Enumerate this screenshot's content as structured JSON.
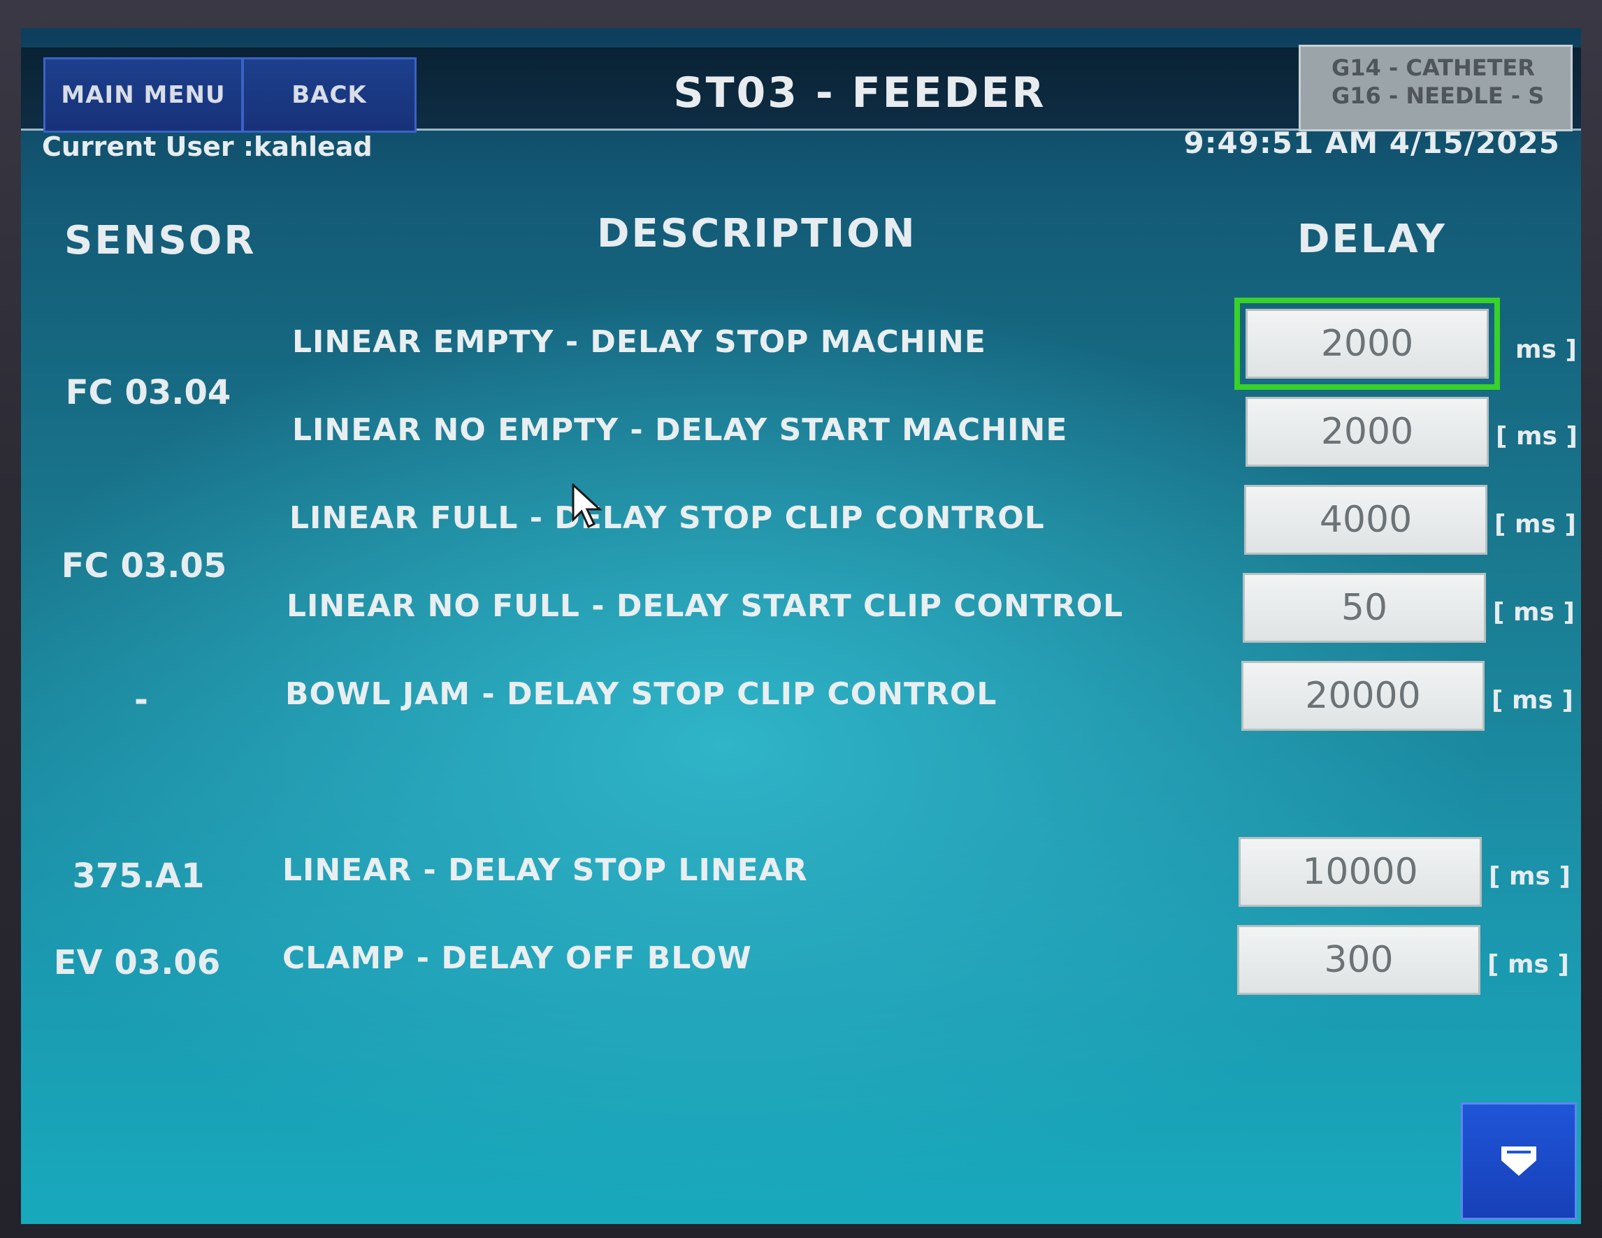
{
  "header": {
    "main_menu_label": "MAIN MENU",
    "back_label": "BACK",
    "title": "ST03 - FEEDER",
    "recipe_line1": "G14 - CATHETER",
    "recipe_line2": "G16 - NEEDLE - S"
  },
  "status": {
    "current_user": "Current User :kahlead",
    "datetime": "9:49:51 AM 4/15/2025"
  },
  "columns": {
    "sensor": "SENSOR",
    "description": "DESCRIPTION",
    "delay": "DELAY"
  },
  "sensors": [
    "FC 03.04",
    "FC 03.05",
    "-",
    "375.A1",
    "EV 03.06"
  ],
  "rows": [
    {
      "description": "LINEAR EMPTY - DELAY STOP MACHINE",
      "value": "2000",
      "unit": "ms ]"
    },
    {
      "description": "LINEAR NO EMPTY - DELAY START MACHINE",
      "value": "2000",
      "unit": "[ ms ]"
    },
    {
      "description": "LINEAR FULL - DELAY STOP CLIP CONTROL",
      "value": "4000",
      "unit": "[ ms ]"
    },
    {
      "description": "LINEAR NO FULL - DELAY START CLIP CONTROL",
      "value": "50",
      "unit": "[ ms ]"
    },
    {
      "description": "BOWL JAM - DELAY STOP CLIP CONTROL",
      "value": "20000",
      "unit": "[ ms ]"
    },
    {
      "description": "LINEAR - DELAY STOP LINEAR",
      "value": "10000",
      "unit": "[ ms ]"
    },
    {
      "description": "CLAMP - DELAY OFF BLOW",
      "value": "300",
      "unit": "[ ms ]"
    }
  ],
  "selected_row_index": 0,
  "colors": {
    "selection_outline": "#39d12a",
    "nav_button": "#1d3f8c",
    "scroll_button": "#1f55d8"
  },
  "icons": {
    "scroll_down": "chevron-down-icon",
    "pointer": "mouse-pointer-icon"
  }
}
